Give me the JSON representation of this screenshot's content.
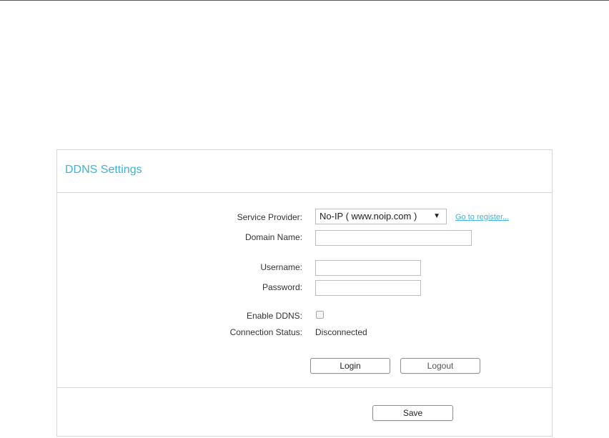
{
  "panel": {
    "title": "DDNS Settings"
  },
  "form": {
    "service_provider": {
      "label": "Service Provider:",
      "selected": "No-IP ( www.noip.com )",
      "register_link": "Go to register..."
    },
    "domain_name": {
      "label": "Domain Name:",
      "value": ""
    },
    "username": {
      "label": "Username:",
      "value": ""
    },
    "password": {
      "label": "Password:",
      "value": ""
    },
    "enable_ddns": {
      "label": "Enable DDNS:",
      "checked": false
    },
    "connection_status": {
      "label": "Connection Status:",
      "value": "Disconnected"
    }
  },
  "buttons": {
    "login": "Login",
    "logout": "Logout",
    "save": "Save"
  },
  "colors": {
    "accent": "#3fb2d6",
    "border": "#d6d6d6"
  },
  "icons": {
    "select_arrow": "dropdown-arrow-icon"
  }
}
